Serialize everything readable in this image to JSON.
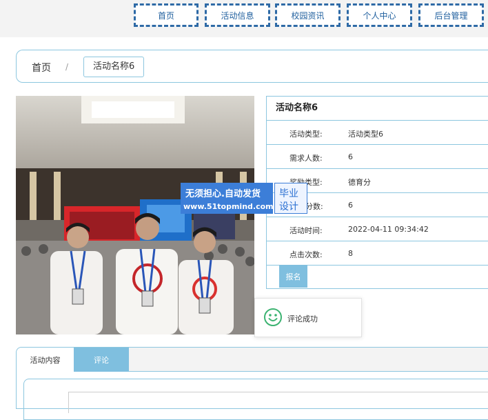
{
  "nav": {
    "items": [
      {
        "label": "首页"
      },
      {
        "label": "活动信息"
      },
      {
        "label": "校园资讯"
      },
      {
        "label": "个人中心"
      },
      {
        "label": "后台管理"
      }
    ]
  },
  "breadcrumb": {
    "home": "首页",
    "separator": "/",
    "current": "活动名称6"
  },
  "detail": {
    "title": "活动名称6",
    "rows": [
      {
        "key": "活动类型:",
        "value": "活动类型6"
      },
      {
        "key": "需求人数:",
        "value": "6"
      },
      {
        "key": "奖励类型:",
        "value": "德育分"
      },
      {
        "key": "分数:",
        "value": "6"
      },
      {
        "key": "活动时间:",
        "value": "2022-04-11 09:34:42"
      },
      {
        "key": "点击次数:",
        "value": "8"
      }
    ],
    "signup_label": "报名"
  },
  "watermark": {
    "line1": "无须担心.自动发货",
    "line2": "www.51topmind.com",
    "right1": "毕业",
    "right2": "设计"
  },
  "toast": {
    "text": "评论成功",
    "icon": "smile-icon"
  },
  "tabs": [
    {
      "label": "活动内容"
    },
    {
      "label": "评论"
    }
  ],
  "colors": {
    "nav_border": "#2e6aa6",
    "accent": "#7fbfdf",
    "border": "#8cc6df",
    "toast_icon": "#3cb371"
  }
}
